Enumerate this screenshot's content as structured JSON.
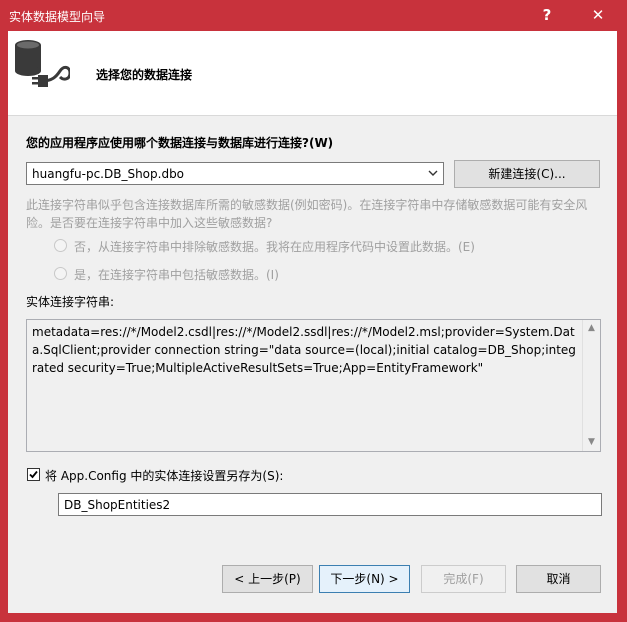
{
  "window": {
    "title": "实体数据模型向导",
    "help_label": "?",
    "close_label": "✕"
  },
  "header": {
    "icon": "database-plug-icon",
    "heading": "选择您的数据连接"
  },
  "connection": {
    "question": "您的应用程序应使用哪个数据连接与数据库进行连接?(W)",
    "selected": "huangfu-pc.DB_Shop.dbo",
    "new_button": "新建连接(C)..."
  },
  "sensitive": {
    "description": "此连接字符串似乎包含连接数据库所需的敏感数据(例如密码)。在连接字符串中存储敏感数据可能有安全风险。是否要在连接字符串中加入这些敏感数据?",
    "option_no": "否，从连接字符串中排除敏感数据。我将在应用程序代码中设置此数据。(E)",
    "option_yes": "是，在连接字符串中包括敏感数据。(I)"
  },
  "entity_conn": {
    "label": "实体连接字符串:",
    "value": "metadata=res://*/Model2.csdl|res://*/Model2.ssdl|res://*/Model2.msl;provider=System.Data.SqlClient;provider connection string=\"data source=(local);initial catalog=DB_Shop;integrated security=True;MultipleActiveResultSets=True;App=EntityFramework\""
  },
  "save_config": {
    "checked": true,
    "label": "将 App.Config 中的实体连接设置另存为(S):",
    "name_value": "DB_ShopEntities2"
  },
  "buttons": {
    "prev": "< 上一步(P)",
    "next": "下一步(N) >",
    "finish": "完成(F)",
    "cancel": "取消"
  },
  "colors": {
    "titlebar": "#c8323c",
    "dialog_bg": "#f0f0f0"
  }
}
